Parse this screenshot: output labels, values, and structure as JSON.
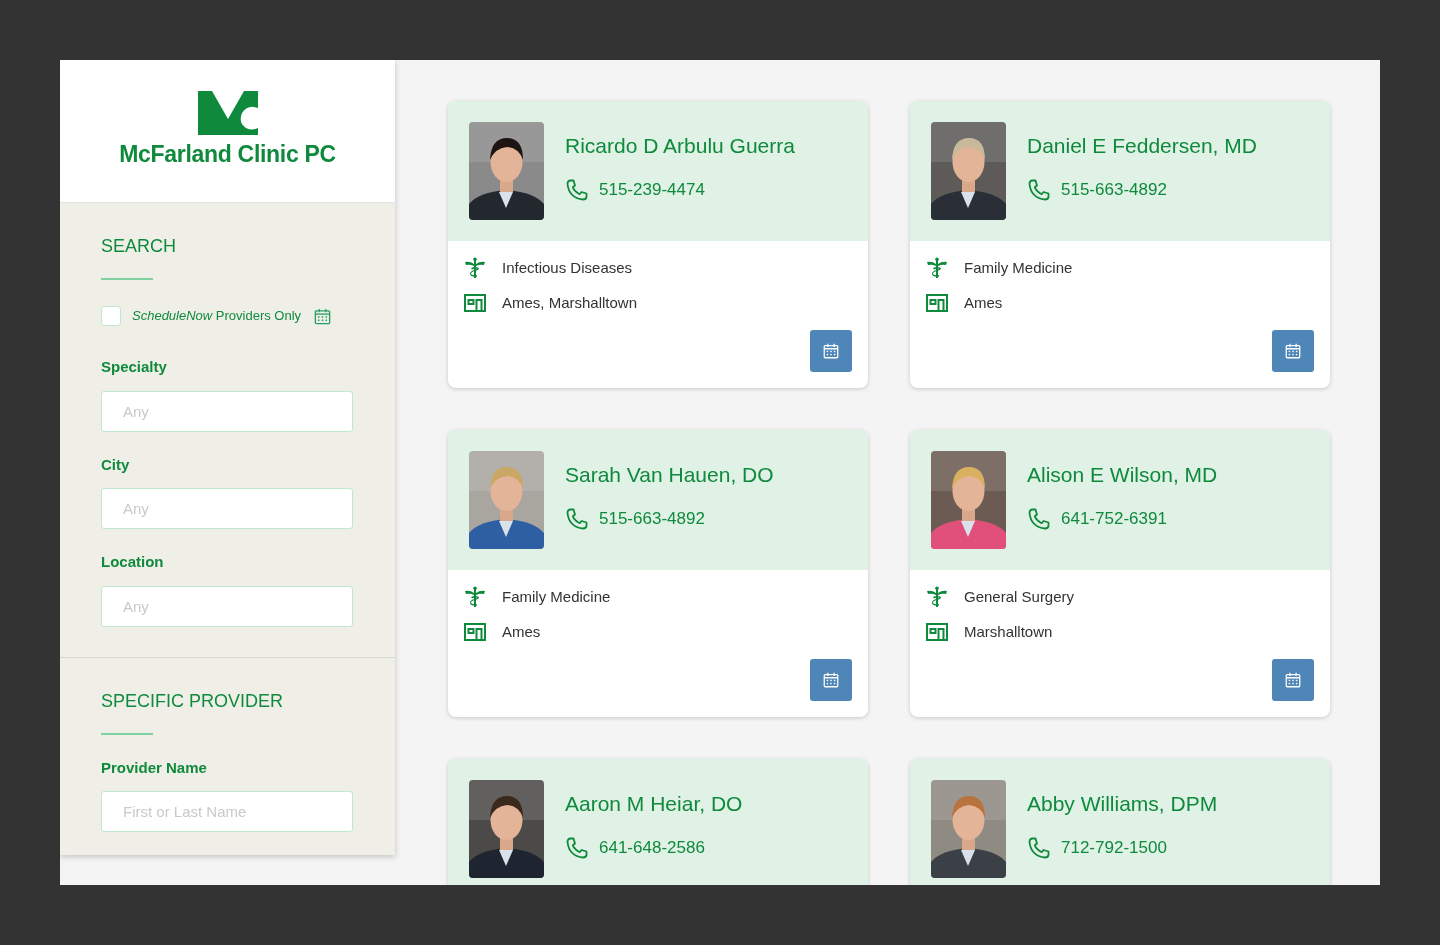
{
  "logo": {
    "name": "McFarland Clinic PC"
  },
  "search": {
    "title": "SEARCH",
    "schedule_filter": {
      "label": "*ScheduleNow* Providers Only",
      "checked": false
    },
    "fields": [
      {
        "label": "Specialty",
        "placeholder": "Any"
      },
      {
        "label": "City",
        "placeholder": "Any"
      },
      {
        "label": "Location",
        "placeholder": "Any"
      }
    ]
  },
  "specific_provider": {
    "title": "SPECIFIC PROVIDER",
    "field": {
      "label": "Provider Name",
      "placeholder": "First or Last Name"
    }
  },
  "providers": [
    {
      "name": "Ricardo D Arbulu Guerra",
      "phone": "515-239-4474",
      "specialty": "Infectious Diseases",
      "locations": "Ames, Marshalltown"
    },
    {
      "name": "Daniel E Feddersen, MD",
      "phone": "515-663-4892",
      "specialty": "Family Medicine",
      "locations": "Ames"
    },
    {
      "name": "Sarah Van Hauen, DO",
      "phone": "515-663-4892",
      "specialty": "Family Medicine",
      "locations": "Ames"
    },
    {
      "name": "Alison E Wilson, MD",
      "phone": "641-752-6391",
      "specialty": "General Surgery",
      "locations": "Marshalltown"
    },
    {
      "name": "Aaron M Heiar, DO",
      "phone": "641-648-2586"
    },
    {
      "name": "Abby Williams, DPM",
      "phone": "712-792-1500"
    }
  ]
}
